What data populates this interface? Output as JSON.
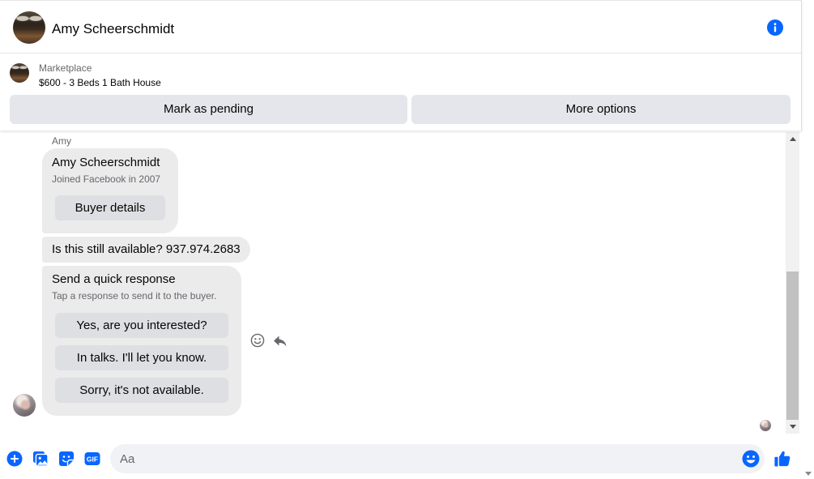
{
  "header": {
    "contact_name": "Amy Scheerschmidt",
    "icons": [
      "info-icon"
    ]
  },
  "listing": {
    "category": "Marketplace",
    "title": "$600 - 3 Beds 1 Bath House",
    "actions": {
      "mark_pending": "Mark as pending",
      "more_options": "More options"
    }
  },
  "thread": {
    "sender_label": "Amy",
    "profile_card": {
      "name": "Amy Scheerschmidt",
      "joined": "Joined Facebook in 2007",
      "button": "Buyer details"
    },
    "message": "Is this still available? 937.974.2683",
    "quick_response": {
      "title": "Send a quick response",
      "subtitle": "Tap a response to send it to the buyer.",
      "options": [
        "Yes, are you interested?",
        "In talks. I'll let you know.",
        "Sorry, it's not available."
      ]
    },
    "message_actions": [
      "smile-icon",
      "reply-icon"
    ],
    "scroll_percent": 100
  },
  "composer": {
    "placeholder": "Aa",
    "gif_label": "GIF",
    "icons": [
      "plus-circle-icon",
      "photo-icon",
      "sticker-icon",
      "gif-icon",
      "emoji-icon",
      "thumbs-up-icon"
    ]
  },
  "colors": {
    "accent": "#0866ff",
    "text": "#050505",
    "secondary_text": "#65676b",
    "bubble": "#ebebec",
    "bubble_button": "#dedfe2",
    "action_button": "#e4e6eb",
    "composer_background": "#f0f2f5"
  }
}
